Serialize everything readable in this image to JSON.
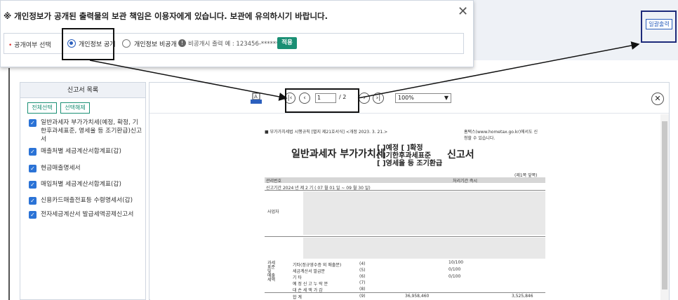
{
  "notice": {
    "title": "※ 개인정보가 공개된 출력물의 보관 책임은 이용자에게 있습니다. 보관에 유의하시기 바랍니다.",
    "close": "✕"
  },
  "disclosure": {
    "label": "공개여부 선택",
    "req": "•",
    "option_public": "개인정보 공개",
    "option_private": "개인정보 비공개",
    "info": "비공개시 출력 예 : 123456-*******",
    "apply": "적용"
  },
  "bulk_print": "일괄출력",
  "panel": {
    "title": "신고서 목록",
    "select_all": "전체선택",
    "deselect_all": "선택해제",
    "items": [
      "일반과세자 부가가치세(예정, 확정, 기한후과세표준, 영세율 등 조기환급)신고서",
      "매출처별 세금계산서합계표(갑)",
      "현금매출명세서",
      "매입처별 세금계산서합계표(갑)",
      "신용카드매출전표등 수령명세서(갑)",
      "전자세금계산서 발급세액공제신고서"
    ]
  },
  "viewer": {
    "page": "1",
    "total": "/ 2",
    "zoom": "100%",
    "print_label": "A"
  },
  "doc": {
    "law": "■ 부가가치세법 시행규칙 [별지 제21호서식] <개정 2023. 3. 21.>",
    "hometax": "홈택스(www.hometax.go.kr)에서도 신청할 수 있습니다.",
    "title_left": "일반과세자 부가가치세",
    "title_mid": "[ ]예정 [ ]확정\n[ ]기한후과세표준\n[ ]영세율 등 조기환급",
    "title_right": "신고서",
    "page_mark": "(제1쪽 앞쪽)",
    "period": "신고기간  2024 년 제 2 기 ( 07 월  01 일 ~ 09 월  30 일)",
    "mgmt": "관리번호",
    "proc": "처리기간  즉시",
    "sa": "사업자",
    "tax": "과세\n표준\n및\n매출\n세액",
    "r1": "10/100",
    "r2": "0/100",
    "r3": "0/100",
    "total_label": "합 계",
    "total_no": "(9)",
    "total_amt": "36,958,460",
    "total_tax": "3,525,846",
    "items": [
      "기타(정규영수증 외 매출분)",
      "세금계산서 발급분",
      "기 타",
      "예 정 신 고 누 락 분",
      "대 손 세 액 가 감"
    ],
    "nos": [
      "(4)",
      "(5)",
      "(6)",
      "(7)",
      "(8)"
    ]
  }
}
